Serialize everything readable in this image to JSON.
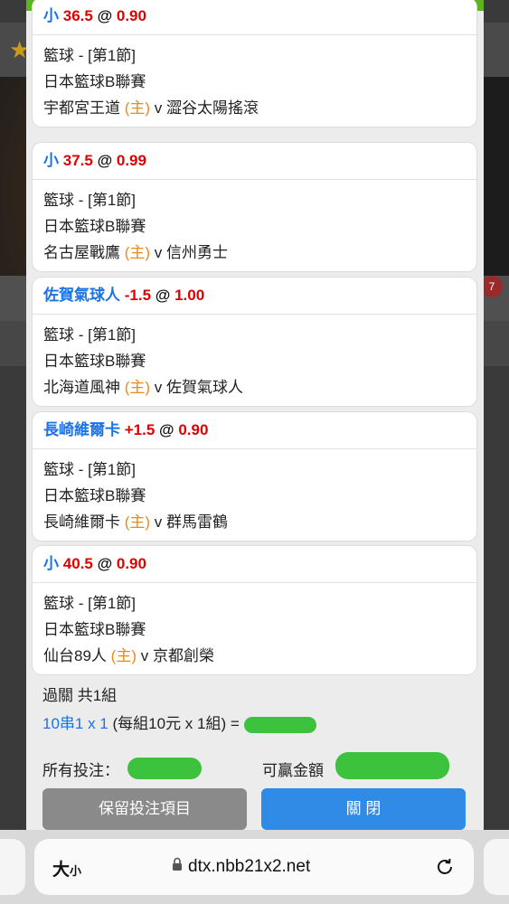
{
  "background": {
    "notification_badge": "7"
  },
  "bets": [
    {
      "selection": "小",
      "line": "36.5",
      "at": "@",
      "odds": "0.90",
      "sport": "籃球 - [第1節]",
      "league": "日本籃球B聯賽",
      "home": "宇都宮王道",
      "home_tag": "(主)",
      "vs": "v",
      "away": "澀谷太陽搖滾"
    },
    {
      "selection": "小",
      "line": "37.5",
      "at": "@",
      "odds": "0.99",
      "sport": "籃球 - [第1節]",
      "league": "日本籃球B聯賽",
      "home": "名古屋戰鷹",
      "home_tag": "(主)",
      "vs": "v",
      "away": "信州勇士"
    },
    {
      "selection": "佐賀氣球人",
      "line": "-1.5",
      "at": "@",
      "odds": "1.00",
      "sport": "籃球 - [第1節]",
      "league": "日本籃球B聯賽",
      "home": "北海道風神",
      "home_tag": "(主)",
      "vs": "v",
      "away": "佐賀氣球人"
    },
    {
      "selection": "長崎維爾卡",
      "line": "+1.5",
      "at": "@",
      "odds": "0.90",
      "sport": "籃球 - [第1節]",
      "league": "日本籃球B聯賽",
      "home": "長崎維爾卡",
      "home_tag": "(主)",
      "vs": "v",
      "away": "群馬雷鶴"
    },
    {
      "selection": "小",
      "line": "40.5",
      "at": "@",
      "odds": "0.90",
      "sport": "籃球 - [第1節]",
      "league": "日本籃球B聯賽",
      "home": "仙台89人",
      "home_tag": "(主)",
      "vs": "v",
      "away": "京都創榮"
    }
  ],
  "summary": {
    "parlay_text": "過關 共1組",
    "combo_text": "10串1 x 1",
    "combo_detail": "(每組10元 x 1組) ="
  },
  "footer": {
    "total_bet_label": "所有投注：",
    "win_label": "可贏金額",
    "keep_button": "保留投注項目",
    "close_button": "關 閉"
  },
  "browser": {
    "text_size_big": "大",
    "text_size_small": "小",
    "url": "dtx.nbb21x2.net"
  },
  "colors": {
    "accent_blue": "#1a73e8",
    "odds_red": "#e10000",
    "home_orange": "#e78a1a",
    "top_bar_green": "#5fb31f",
    "close_button": "#2f8be6",
    "keep_button": "#8a8a8a"
  }
}
